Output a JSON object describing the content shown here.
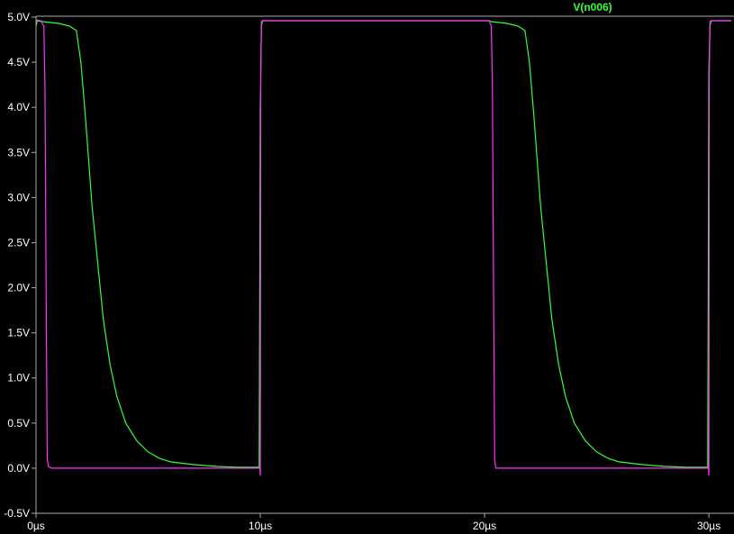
{
  "chart_data": {
    "type": "line",
    "title": "",
    "xlabel": "",
    "ylabel": "",
    "xlim": [
      0,
      31
    ],
    "ylim": [
      -0.5,
      5.0
    ],
    "x_ticks": [
      0,
      10,
      20,
      30
    ],
    "x_tick_labels": [
      "0µs",
      "10µs",
      "20µs",
      "30µs"
    ],
    "y_ticks": [
      5.0,
      4.5,
      4.0,
      3.5,
      3.0,
      2.5,
      2.0,
      1.5,
      1.0,
      0.5,
      0.0,
      -0.5
    ],
    "y_tick_labels": [
      "5.0V",
      "4.5V",
      "4.0V",
      "3.5V",
      "3.0V",
      "2.5V",
      "2.0V",
      "1.5V",
      "1.0V",
      "0.5V",
      "0.0V",
      "-0.5V"
    ],
    "grid": false,
    "legend_position": "top-right",
    "colors": {
      "background": "#000000",
      "axis": "#aaaaaa",
      "text": "#ffffff",
      "green": "#33ff33",
      "magenta": "#ff33ff"
    },
    "series": [
      {
        "name": "V(n006)",
        "color": "#33ff33",
        "x": [
          0.0,
          0.05,
          0.3,
          1.0,
          1.5,
          1.8,
          2.0,
          2.2,
          2.5,
          2.8,
          3.0,
          3.3,
          3.6,
          4.0,
          4.5,
          5.0,
          5.5,
          6.0,
          7.0,
          8.0,
          9.0,
          9.95,
          10.0,
          10.05,
          10.1,
          10.3,
          12.0,
          15.0,
          18.0,
          20.0,
          20.2,
          20.3,
          21.0,
          21.5,
          21.8,
          22.0,
          22.2,
          22.5,
          22.8,
          23.0,
          23.3,
          23.6,
          24.0,
          24.5,
          25.0,
          25.5,
          26.0,
          27.0,
          28.0,
          29.0,
          29.95,
          30.0,
          30.05,
          30.1,
          30.3,
          31.0
        ],
        "y": [
          4.9,
          4.96,
          4.95,
          4.93,
          4.9,
          4.85,
          4.5,
          3.9,
          2.9,
          2.15,
          1.65,
          1.15,
          0.8,
          0.5,
          0.3,
          0.18,
          0.11,
          0.07,
          0.04,
          0.02,
          0.01,
          0.01,
          3.97,
          4.9,
          4.96,
          4.96,
          4.96,
          4.96,
          4.96,
          4.96,
          4.96,
          4.95,
          4.93,
          4.9,
          4.85,
          4.5,
          3.9,
          2.9,
          2.15,
          1.65,
          1.15,
          0.8,
          0.5,
          0.3,
          0.18,
          0.11,
          0.07,
          0.04,
          0.02,
          0.01,
          0.01,
          4.4,
          4.9,
          4.96,
          4.96,
          4.96
        ]
      },
      {
        "name": "",
        "color": "#ff33ff",
        "x": [
          0.0,
          0.2,
          0.35,
          0.4,
          0.45,
          0.5,
          0.55,
          0.7,
          9.98,
          10.0,
          10.02,
          10.05,
          10.1,
          20.2,
          20.3,
          20.35,
          20.4,
          20.45,
          20.5,
          20.7,
          29.98,
          30.0,
          30.02,
          30.05,
          30.1,
          31.0
        ],
        "y": [
          4.97,
          4.96,
          4.9,
          4.2,
          2.0,
          0.1,
          0.02,
          0.0,
          0.0,
          -0.08,
          4.4,
          4.95,
          4.96,
          4.96,
          4.9,
          4.2,
          2.0,
          0.1,
          0.0,
          0.0,
          0.0,
          -0.08,
          4.4,
          4.95,
          4.96,
          4.96
        ]
      }
    ]
  }
}
